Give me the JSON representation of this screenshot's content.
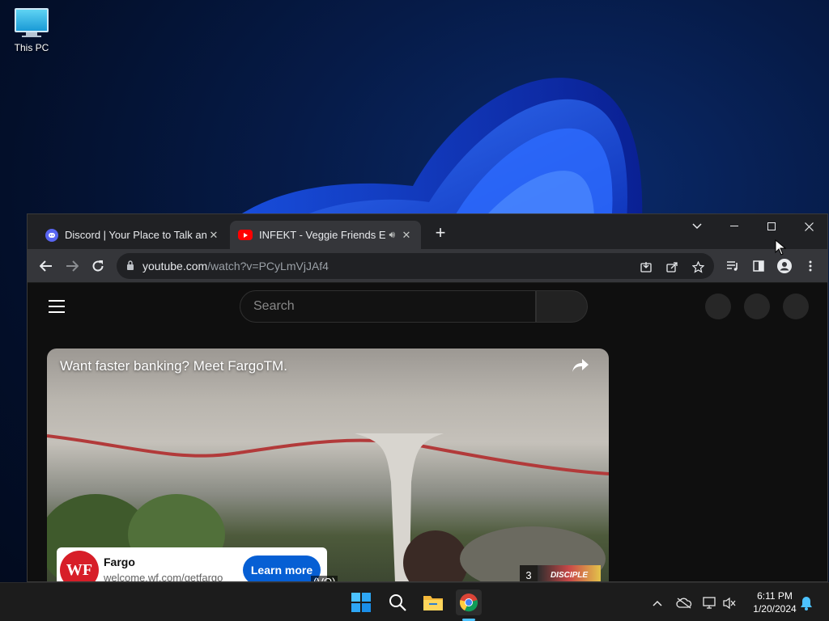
{
  "desktop": {
    "icons": [
      {
        "label": "This PC",
        "icon": "monitor-icon"
      }
    ]
  },
  "browser": {
    "tabs": [
      {
        "title": "Discord | Your Place to Talk and Hang Out",
        "icon": "discord-icon",
        "active": false
      },
      {
        "title": "INFEKT - Veggie Friends EP [",
        "icon": "youtube-icon",
        "active": true,
        "audio": true
      }
    ],
    "url": {
      "host": "youtube.com",
      "path": "/watch?v=PCyLmVjJAf4"
    }
  },
  "youtube": {
    "search_placeholder": "Search",
    "ad": {
      "title": "Want faster banking? Meet FargoTM.",
      "brand_logo_text": "WF",
      "brand": "Fargo",
      "url": "welcome.wf.com/getfargo",
      "cta": "Learn more",
      "caption": "(VO)",
      "skip_count": "3",
      "thumb_text": "DISCIPLE"
    }
  },
  "taskbar": {
    "time": "6:11 PM",
    "date": "1/20/2024"
  },
  "colors": {
    "chrome_dark": "#202124",
    "chrome_toolbar": "#35363a",
    "youtube_bg": "#0f0f0f",
    "cta_blue": "#065fd4",
    "wf_red": "#d71e28"
  }
}
